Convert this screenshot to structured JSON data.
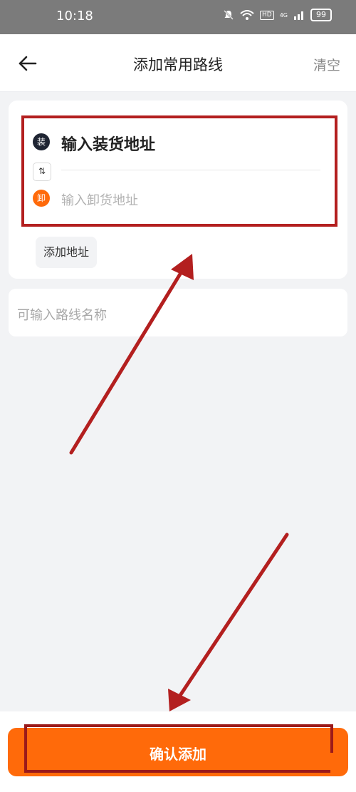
{
  "status_bar": {
    "time": "10:18",
    "network": "4G",
    "hd": "HD",
    "battery": "99"
  },
  "nav": {
    "title": "添加常用路线",
    "clear_label": "清空"
  },
  "address": {
    "load_badge": "装",
    "unload_badge": "卸",
    "load_placeholder": "输入装货地址",
    "unload_placeholder": "输入卸货地址",
    "swap_symbol": "⇅",
    "add_address_label": "添加地址"
  },
  "route_name": {
    "placeholder": "可输入路线名称"
  },
  "confirm": {
    "label": "确认添加"
  },
  "colors": {
    "accent": "#ff6a0a",
    "annotation": "#b31f1f"
  }
}
